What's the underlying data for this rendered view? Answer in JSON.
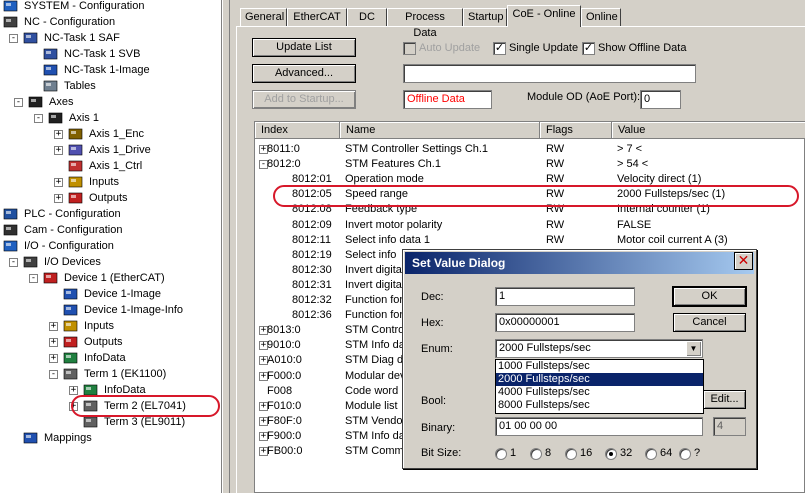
{
  "tree": {
    "items": [
      {
        "label": "SYSTEM - Configuration",
        "icon": "system-config-icon",
        "exp": "+"
      },
      {
        "label": "NC - Configuration",
        "icon": "nc-config-icon",
        "exp": "-"
      },
      {
        "label": "NC-Task 1 SAF",
        "icon": "task-icon",
        "exp": "-"
      },
      {
        "label": "NC-Task 1 SVB",
        "icon": "task-icon",
        "exp": ""
      },
      {
        "label": "NC-Task 1-Image",
        "icon": "image-icon",
        "exp": ""
      },
      {
        "label": "Tables",
        "icon": "table-icon",
        "exp": ""
      },
      {
        "label": "Axes",
        "icon": "axes-icon",
        "exp": "-"
      },
      {
        "label": "Axis 1",
        "icon": "axis-icon",
        "exp": "-"
      },
      {
        "label": "Axis 1_Enc",
        "icon": "encoder-icon",
        "exp": "+"
      },
      {
        "label": "Axis 1_Drive",
        "icon": "drive-icon",
        "exp": "+"
      },
      {
        "label": "Axis 1_Ctrl",
        "icon": "controller-icon",
        "exp": ""
      },
      {
        "label": "Inputs",
        "icon": "inputs-icon",
        "exp": "+"
      },
      {
        "label": "Outputs",
        "icon": "outputs-icon",
        "exp": "+"
      },
      {
        "label": "PLC - Configuration",
        "icon": "plc-config-icon",
        "exp": ""
      },
      {
        "label": "Cam - Configuration",
        "icon": "cam-config-icon",
        "exp": ""
      },
      {
        "label": "I/O - Configuration",
        "icon": "io-config-icon",
        "exp": "-"
      },
      {
        "label": "I/O Devices",
        "icon": "io-devices-icon",
        "exp": "-"
      },
      {
        "label": "Device 1 (EtherCAT)",
        "icon": "ethercat-device-icon",
        "exp": "-"
      },
      {
        "label": "Device 1-Image",
        "icon": "image-icon",
        "exp": ""
      },
      {
        "label": "Device 1-Image-Info",
        "icon": "image-icon",
        "exp": ""
      },
      {
        "label": "Inputs",
        "icon": "inputs-icon",
        "exp": "+"
      },
      {
        "label": "Outputs",
        "icon": "outputs-icon",
        "exp": "+"
      },
      {
        "label": "InfoData",
        "icon": "infodata-icon",
        "exp": "+"
      },
      {
        "label": "Term 1 (EK1100)",
        "icon": "terminal-icon",
        "exp": "-"
      },
      {
        "label": "InfoData",
        "icon": "infodata-icon",
        "exp": "+"
      },
      {
        "label": "Term 2 (EL7041)",
        "icon": "terminal-icon",
        "exp": "+"
      },
      {
        "label": "Term 3 (EL9011)",
        "icon": "terminal-icon",
        "exp": ""
      },
      {
        "label": "Mappings",
        "icon": "mappings-icon",
        "exp": ""
      }
    ]
  },
  "tabs": [
    "General",
    "EtherCAT",
    "DC",
    "Process Data",
    "Startup",
    "CoE - Online",
    "Online"
  ],
  "active_tab": "CoE - Online",
  "panel": {
    "update_list": "Update List",
    "advanced": "Advanced...",
    "add_to_startup": "Add to Startup...",
    "auto_update": "Auto Update",
    "single_update": "Single Update",
    "show_offline": "Show Offline Data",
    "offline_data": "Offline Data",
    "module_od_label": "Module OD (AoE Port):",
    "module_od_value": "0"
  },
  "grid": {
    "headers": [
      "Index",
      "Name",
      "Flags",
      "Value"
    ],
    "rows": [
      {
        "exp": "+",
        "index": "8011:0",
        "name": "STM Controller Settings Ch.1",
        "flags": "RW",
        "value": "> 7 <",
        "sub": false
      },
      {
        "exp": "-",
        "index": "8012:0",
        "name": "STM Features Ch.1",
        "flags": "RW",
        "value": "> 54 <",
        "sub": false
      },
      {
        "exp": "",
        "index": "8012:01",
        "name": "Operation mode",
        "flags": "RW",
        "value": "Velocity direct (1)",
        "sub": true
      },
      {
        "exp": "",
        "index": "8012:05",
        "name": "Speed range",
        "flags": "RW",
        "value": "2000 Fullsteps/sec (1)",
        "sub": true
      },
      {
        "exp": "",
        "index": "8012:08",
        "name": "Feedback type",
        "flags": "RW",
        "value": "Internal counter (1)",
        "sub": true
      },
      {
        "exp": "",
        "index": "8012:09",
        "name": "Invert motor polarity",
        "flags": "RW",
        "value": "FALSE",
        "sub": true
      },
      {
        "exp": "",
        "index": "8012:11",
        "name": "Select info data 1",
        "flags": "RW",
        "value": "Motor coil current A (3)",
        "sub": true
      },
      {
        "exp": "",
        "index": "8012:19",
        "name": "Select info",
        "flags": "",
        "value": "",
        "sub": true
      },
      {
        "exp": "",
        "index": "8012:30",
        "name": "Invert digital",
        "flags": "",
        "value": "",
        "sub": true
      },
      {
        "exp": "",
        "index": "8012:31",
        "name": "Invert digital",
        "flags": "",
        "value": "",
        "sub": true
      },
      {
        "exp": "",
        "index": "8012:32",
        "name": "Function for",
        "flags": "",
        "value": "",
        "sub": true
      },
      {
        "exp": "",
        "index": "8012:36",
        "name": "Function for",
        "flags": "",
        "value": "",
        "sub": true
      },
      {
        "exp": "+",
        "index": "8013:0",
        "name": "STM Control",
        "flags": "",
        "value": "",
        "sub": false
      },
      {
        "exp": "+",
        "index": "9010:0",
        "name": "STM Info da",
        "flags": "",
        "value": "",
        "sub": false
      },
      {
        "exp": "+",
        "index": "A010:0",
        "name": "STM Diag da",
        "flags": "",
        "value": "",
        "sub": false
      },
      {
        "exp": "+",
        "index": "F000:0",
        "name": "Modular dev",
        "flags": "",
        "value": "",
        "sub": false
      },
      {
        "exp": "",
        "index": "F008",
        "name": "Code word",
        "flags": "",
        "value": "",
        "sub": false
      },
      {
        "exp": "+",
        "index": "F010:0",
        "name": "Module list",
        "flags": "",
        "value": "",
        "sub": false
      },
      {
        "exp": "+",
        "index": "F80F:0",
        "name": "STM Vendor",
        "flags": "",
        "value": "",
        "sub": false
      },
      {
        "exp": "+",
        "index": "F900:0",
        "name": "STM Info da",
        "flags": "",
        "value": "",
        "sub": false
      },
      {
        "exp": "+",
        "index": "FB00:0",
        "name": "STM Comma",
        "flags": "",
        "value": "",
        "sub": false
      }
    ]
  },
  "dialog": {
    "title": "Set Value Dialog",
    "dec_label": "Dec:",
    "dec_value": "1",
    "hex_label": "Hex:",
    "hex_value": "0x00000001",
    "enum_label": "Enum:",
    "enum_value": "2000 Fullsteps/sec",
    "enum_options": [
      "1000 Fullsteps/sec",
      "2000 Fullsteps/sec",
      "4000 Fullsteps/sec",
      "8000 Fullsteps/sec"
    ],
    "enum_selected_index": 1,
    "bool_label": "Bool:",
    "binary_label": "Binary:",
    "binary_value": "01 00 00 00",
    "binary_len": "4",
    "bitsize_label": "Bit Size:",
    "bitsizes": [
      "1",
      "8",
      "16",
      "32",
      "64",
      "?"
    ],
    "bitsize_selected": "32",
    "ok": "OK",
    "cancel": "Cancel",
    "edit": "Edit..."
  },
  "colors": {
    "highlight": "#d7182a",
    "selection": "#0a246a",
    "error_text": "#ff0000"
  }
}
